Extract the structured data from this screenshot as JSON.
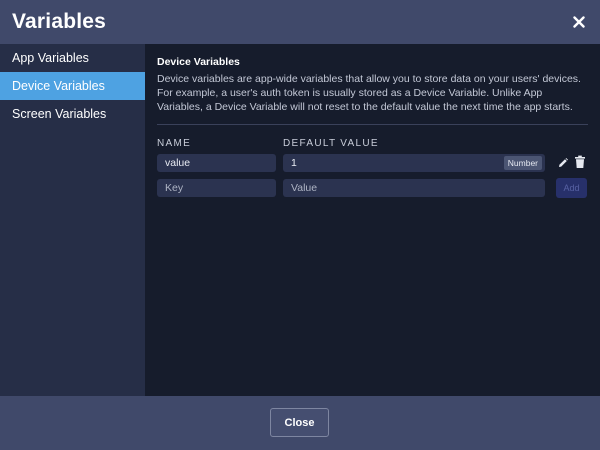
{
  "dialog": {
    "title": "Variables",
    "close_icon": "close-icon"
  },
  "sidebar": {
    "items": [
      {
        "label": "App Variables",
        "active": false
      },
      {
        "label": "Device Variables",
        "active": true
      },
      {
        "label": "Screen Variables",
        "active": false
      }
    ]
  },
  "main": {
    "section_title": "Device Variables",
    "description": "Device variables are app-wide variables that allow you to store data on your users' devices. For example, a user's auth token is usually stored as a Device Variable. Unlike App Variables, a Device Variable will not reset to the default value the next time the app starts.",
    "columns": {
      "name": "NAME",
      "default_value": "DEFAULT VALUE"
    },
    "rows": [
      {
        "name": "value",
        "default_value": "1",
        "type": "Number"
      }
    ],
    "new_row": {
      "key_placeholder": "Key",
      "value_placeholder": "Value",
      "add_label": "Add"
    }
  },
  "footer": {
    "close_label": "Close"
  },
  "colors": {
    "active_item": "#4ea2e2",
    "header_bg": "#40496a",
    "sidebar_bg": "#262e47",
    "main_bg": "#161c2c"
  }
}
